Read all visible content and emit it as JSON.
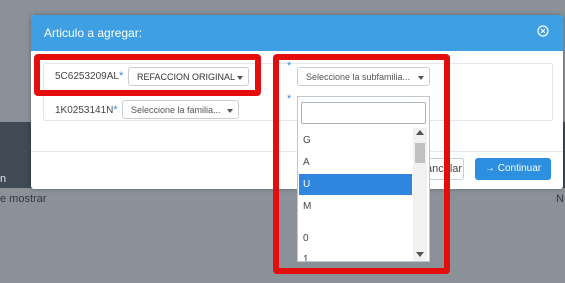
{
  "background": {
    "left_text": "n",
    "left_footer": "e mostrar",
    "right_footer": "N"
  },
  "modal": {
    "title": "Articulo a agregar:",
    "close_icon": "close-circle-icon",
    "rows": [
      {
        "code": "5C6253209AL",
        "required": "*",
        "value": "REFACCION ORIGINAL"
      },
      {
        "code": "1K0253141N",
        "required": "*",
        "value": "Seleccione la familia..."
      }
    ],
    "subfamily": {
      "required": "*",
      "placeholder": "Seleccione la subfamilia..."
    },
    "search_required": "*",
    "buttons": {
      "cancel_label": "ancelar",
      "continue_label": "→ Continuar"
    }
  },
  "dropdown": {
    "search_value": "",
    "options": [
      "G",
      "A",
      "U",
      "M",
      "",
      "0",
      "1"
    ],
    "selected": "U"
  },
  "colors": {
    "header": "#3e9fe3",
    "primary": "#2c8fe0",
    "highlight": "#e30d0d"
  }
}
